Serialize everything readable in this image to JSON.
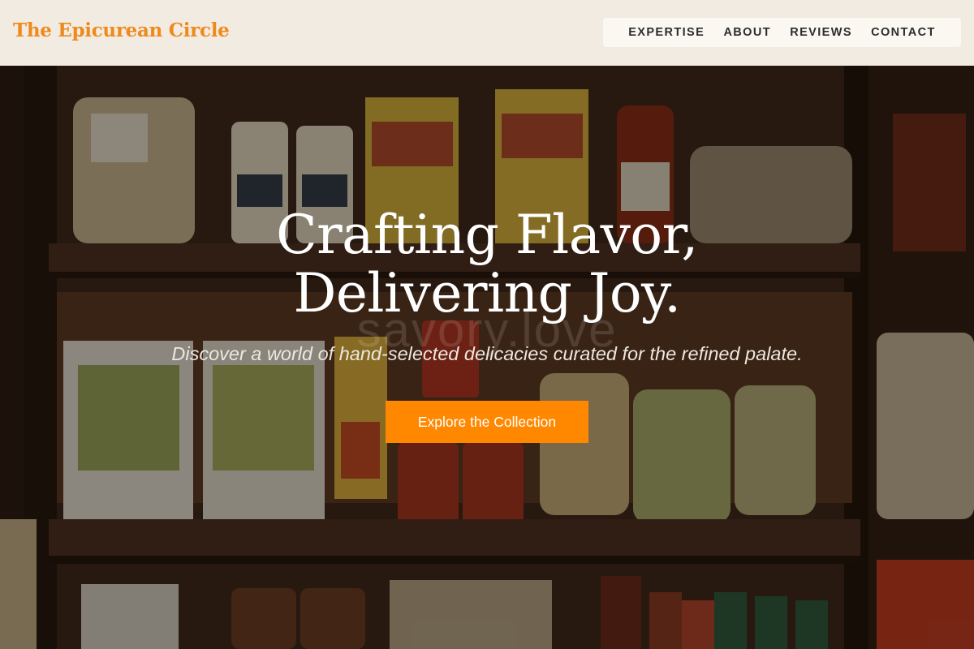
{
  "brand": {
    "name": "The Epicurean Circle"
  },
  "nav": {
    "items": [
      {
        "label": "EXPERTISE"
      },
      {
        "label": "ABOUT"
      },
      {
        "label": "REVIEWS"
      },
      {
        "label": "CONTACT"
      }
    ]
  },
  "hero": {
    "title_line1": "Crafting Flavor,",
    "title_line2": "Delivering Joy.",
    "watermark": "savory.love",
    "subtitle": "Discover a world of hand-selected delicacies curated for the refined palate.",
    "cta_label": "Explore the Collection"
  },
  "colors": {
    "accent": "#ff8800",
    "brand": "#ee8a1c",
    "header_bg": "#faf5eb",
    "nav_text": "#2d2d2d"
  }
}
